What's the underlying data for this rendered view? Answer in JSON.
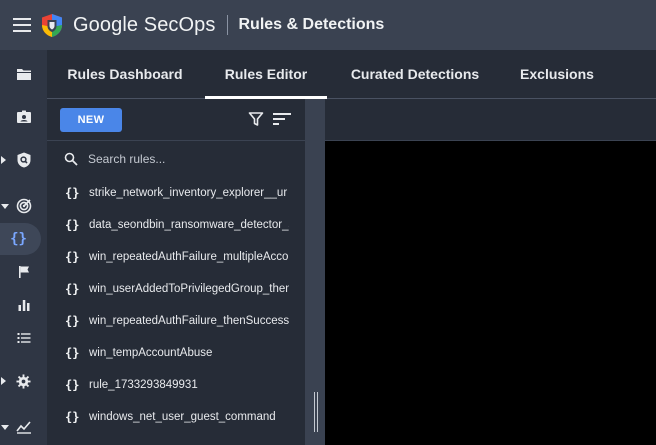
{
  "app": {
    "brand": "Google SecOps",
    "section": "Rules & Detections"
  },
  "tabs": [
    {
      "label": "Rules Dashboard",
      "active": false
    },
    {
      "label": "Rules Editor",
      "active": true
    },
    {
      "label": "Curated Detections",
      "active": false
    },
    {
      "label": "Exclusions",
      "active": false
    }
  ],
  "panel": {
    "new_label": "NEW",
    "search_placeholder": "Search rules..."
  },
  "rules": [
    "strike_network_inventory_explorer__ur",
    "data_seondbin_ransomware_detector_s",
    "win_repeatedAuthFailure_multipleAccou",
    "win_userAddedToPrivilegedGroup_then",
    "win_repeatedAuthFailure_thenSuccess",
    "win_tempAccountAbuse",
    "rule_1733293849931",
    "windows_net_user_guest_command"
  ],
  "rail_icons": [
    "folder-icon",
    "contact-card-icon",
    "shield-search-icon",
    "radar-icon",
    "code-braces-icon",
    "flag-icon",
    "bar-chart-icon",
    "list-icon",
    "settings-gear-icon",
    "trending-chart-icon"
  ],
  "colors": {
    "topbar": "#3a4251",
    "rail": "#2f3644",
    "panel": "#262c37",
    "accent": "#4a86e8"
  }
}
